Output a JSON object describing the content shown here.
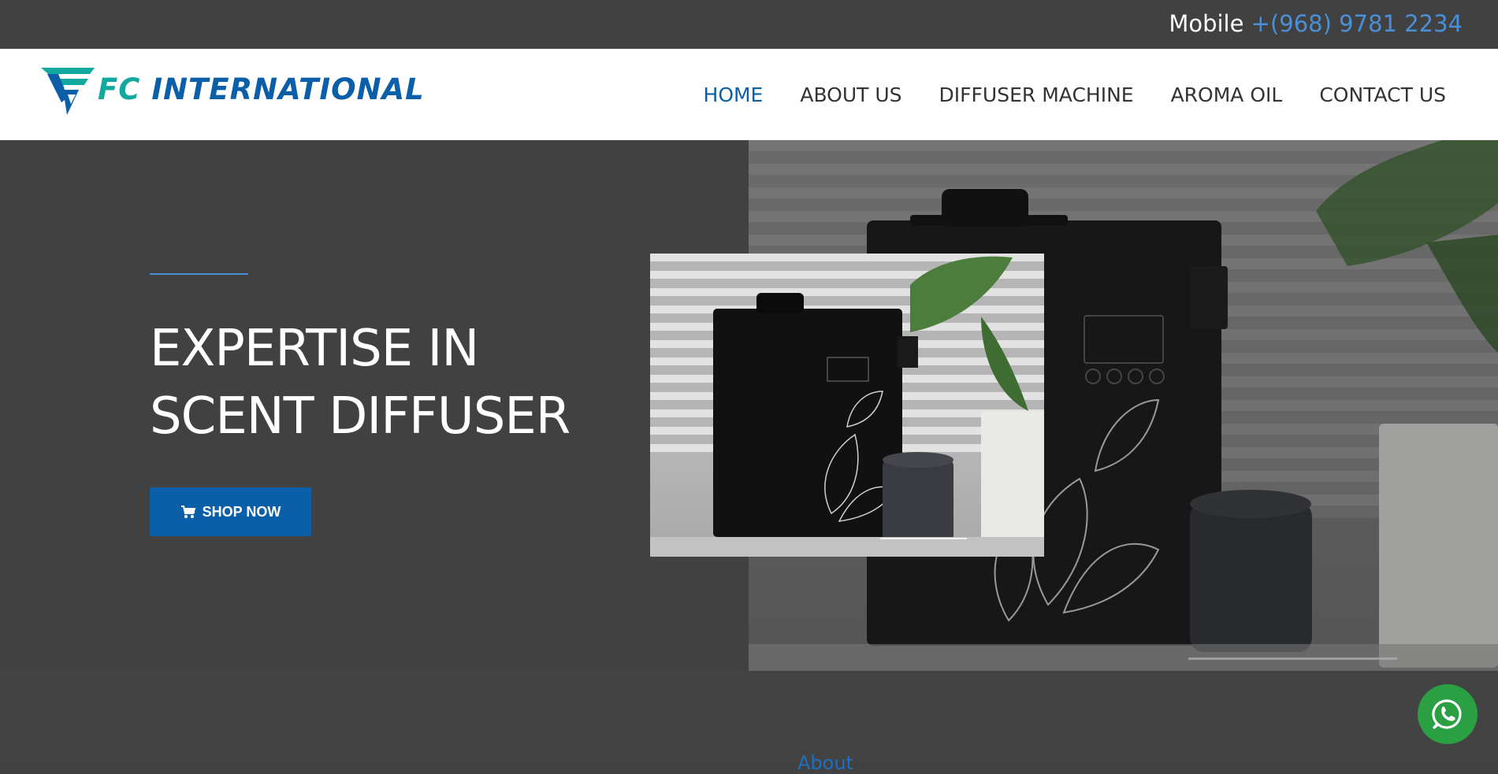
{
  "topbar": {
    "mobile_label": "Mobile",
    "phone": "+(968) 9781 2234"
  },
  "header": {
    "logo_fc": "FC",
    "logo_intl": "INTERNATIONAL",
    "nav": [
      {
        "label": "HOME",
        "active": true
      },
      {
        "label": "ABOUT US",
        "active": false
      },
      {
        "label": "DIFFUSER MACHINE",
        "active": false
      },
      {
        "label": "AROMA OIL",
        "active": false
      },
      {
        "label": "CONTACT US",
        "active": false
      }
    ]
  },
  "hero": {
    "title_line1": "EXPERTISE IN",
    "title_line2": "SCENT DIFFUSER",
    "button_label": "SHOP NOW",
    "button_icon": "cart-icon"
  },
  "about": {
    "heading": "About"
  },
  "floating": {
    "icon": "whatsapp-icon"
  },
  "colors": {
    "primary": "#0b5ea8",
    "teal": "#11a8a0",
    "dark_bg": "#414141",
    "whatsapp": "#2aa043",
    "link": "#4a90d9"
  }
}
